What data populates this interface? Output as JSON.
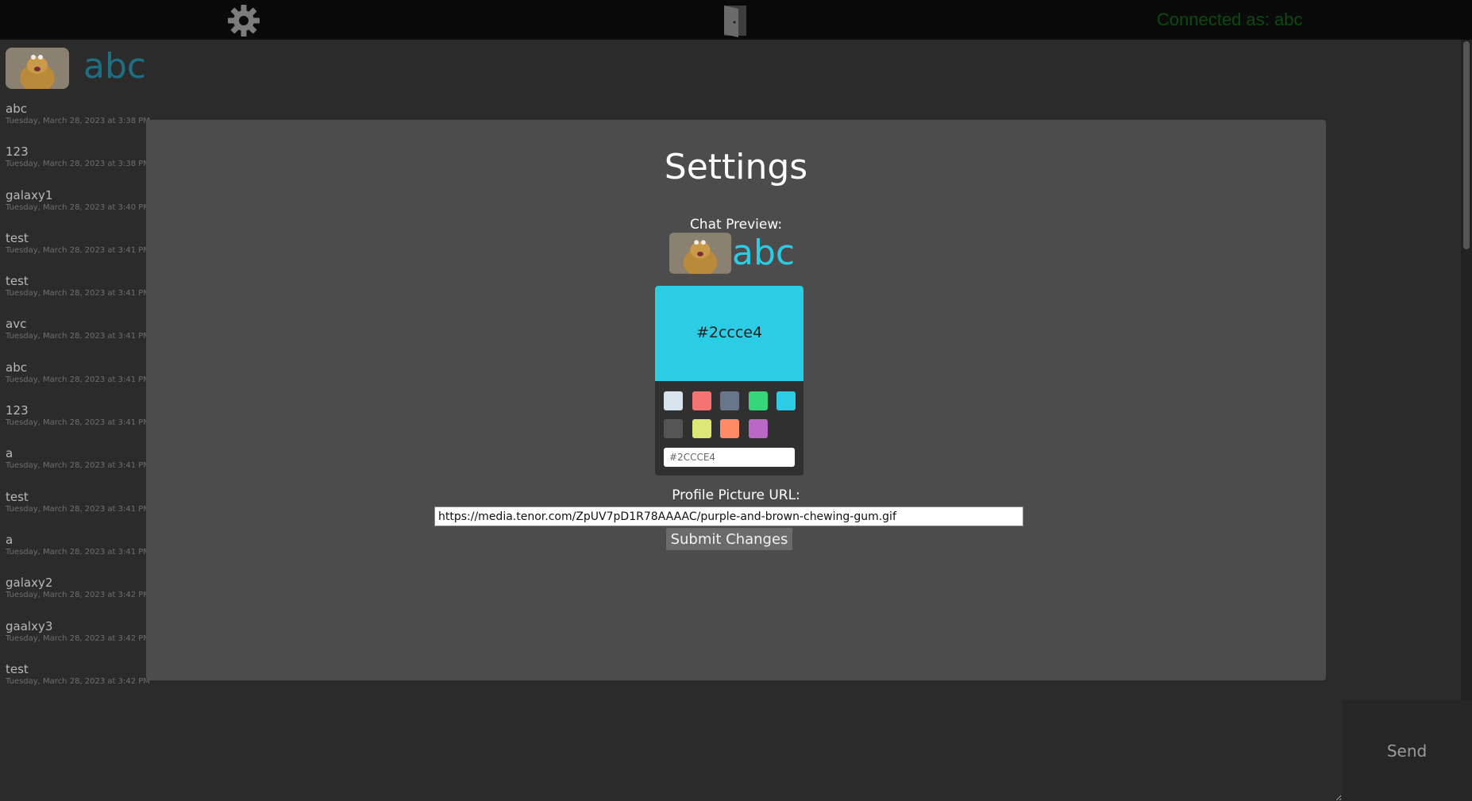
{
  "topbar": {
    "settings_icon": "gear-icon",
    "logout_icon": "door-icon",
    "connected_text": "Connected as: abc"
  },
  "header": {
    "username": "abc",
    "username_color": "#1f6f83"
  },
  "messages": [
    {
      "text": "abc",
      "time": "Tuesday, March 28, 2023 at 3:38 PM"
    },
    {
      "text": "123",
      "time": "Tuesday, March 28, 2023 at 3:38 PM"
    },
    {
      "text": "galaxy1",
      "time": "Tuesday, March 28, 2023 at 3:40 PM"
    },
    {
      "text": "test",
      "time": "Tuesday, March 28, 2023 at 3:41 PM"
    },
    {
      "text": "test",
      "time": "Tuesday, March 28, 2023 at 3:41 PM"
    },
    {
      "text": "avc",
      "time": "Tuesday, March 28, 2023 at 3:41 PM"
    },
    {
      "text": "abc",
      "time": "Tuesday, March 28, 2023 at 3:41 PM"
    },
    {
      "text": "123",
      "time": "Tuesday, March 28, 2023 at 3:41 PM"
    },
    {
      "text": "a",
      "time": "Tuesday, March 28, 2023 at 3:41 PM"
    },
    {
      "text": "test",
      "time": "Tuesday, March 28, 2023 at 3:41 PM"
    },
    {
      "text": "a",
      "time": "Tuesday, March 28, 2023 at 3:41 PM"
    },
    {
      "text": "galaxy2",
      "time": "Tuesday, March 28, 2023 at 3:42 PM"
    },
    {
      "text": "gaalxy3",
      "time": "Tuesday, March 28, 2023 at 3:42 PM"
    },
    {
      "text": "test",
      "time": "Tuesday, March 28, 2023 at 3:42 PM"
    }
  ],
  "settings": {
    "title": "Settings",
    "preview_label": "Chat Preview:",
    "preview_name": "abc",
    "selected_color": "#2ccce4",
    "picker_hex_label": "#2ccce4",
    "picker_input_value": "#2CCCE4",
    "swatches": [
      "#d9e3f0",
      "#f47373",
      "#697689",
      "#37d67a",
      "#2ccce4",
      "#555555",
      "#dce775",
      "#ff8a65",
      "#ba68c8"
    ],
    "url_label": "Profile Picture URL:",
    "url_value": "https://media.tenor.com/ZpUV7pD1R78AAAAC/purple-and-brown-chewing-gum.gif",
    "submit_label": "Submit Changes"
  },
  "composer": {
    "send_label": "Send"
  }
}
